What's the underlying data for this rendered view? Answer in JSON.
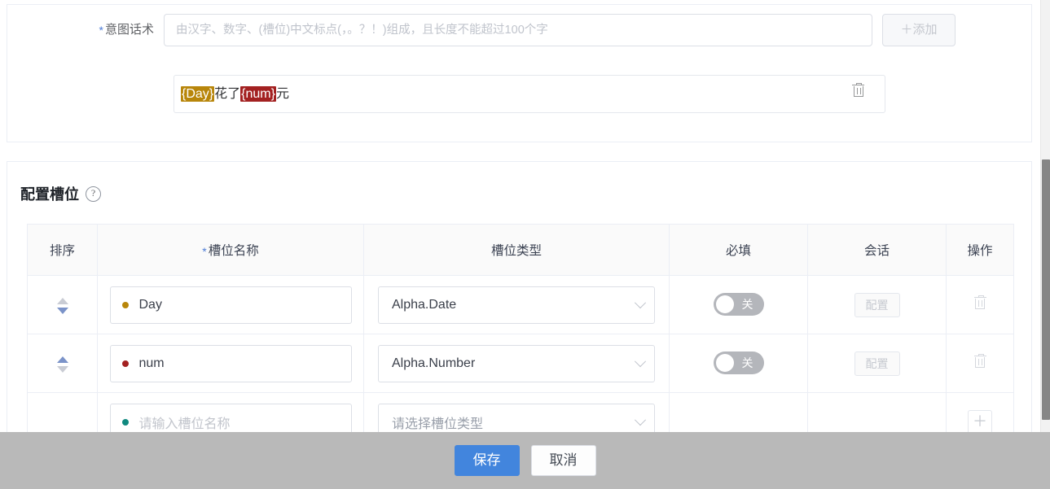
{
  "utterance_section": {
    "label": "意图话术",
    "required_mark": "*",
    "input_placeholder": "由汉字、数字、(槽位)中文标点(，。？！)组成，且长度不能超过100个字",
    "input_value": "",
    "add_button": "＋添加",
    "items": [
      {
        "parts": [
          {
            "text": "{Day}",
            "type": "slot",
            "color": "#b8860b"
          },
          {
            "text": "花了",
            "type": "plain",
            "color": ""
          },
          {
            "text": "{num}",
            "type": "slot",
            "color": "#a32121"
          },
          {
            "text": "元",
            "type": "plain",
            "color": ""
          }
        ],
        "delete_icon": "trash-icon"
      }
    ]
  },
  "slots_section": {
    "title": "配置槽位",
    "help_icon": "question-circle-icon",
    "help_glyph": "?",
    "table": {
      "columns": [
        {
          "key": "order",
          "label": "排序",
          "required": false
        },
        {
          "key": "name",
          "label": "槽位名称",
          "required": true
        },
        {
          "key": "type",
          "label": "槽位类型",
          "required": false
        },
        {
          "key": "required",
          "label": "必填",
          "required": false
        },
        {
          "key": "session",
          "label": "会话",
          "required": false
        },
        {
          "key": "action",
          "label": "操作",
          "required": false
        }
      ],
      "rows": [
        {
          "sort_up_active": false,
          "sort_down_active": true,
          "dot_color": "#b8860b",
          "name_value": "Day",
          "name_placeholder": "",
          "type_value": "Alpha.Date",
          "type_placeholder": "",
          "toggle_label": "关",
          "toggle_on": false,
          "session_button": "配置",
          "session_button_disabled": true,
          "action_icon": "trash-icon",
          "action_kind": "delete"
        },
        {
          "sort_up_active": true,
          "sort_down_active": false,
          "dot_color": "#a32121",
          "name_value": "num",
          "name_placeholder": "",
          "type_value": "Alpha.Number",
          "type_placeholder": "",
          "toggle_label": "关",
          "toggle_on": false,
          "session_button": "配置",
          "session_button_disabled": true,
          "action_icon": "trash-icon",
          "action_kind": "delete"
        },
        {
          "sort_up_active": false,
          "sort_down_active": false,
          "dot_color": "#10897f",
          "name_value": "",
          "name_placeholder": "请输入槽位名称",
          "type_value": "",
          "type_placeholder": "请选择槽位类型",
          "toggle_label": "",
          "toggle_on": false,
          "session_button": "",
          "session_button_disabled": true,
          "action_icon": "plus-icon",
          "action_kind": "add",
          "action_label": "＋"
        }
      ]
    }
  },
  "footer": {
    "save_label": "保存",
    "cancel_label": "取消",
    "primary_color": "#4285dd"
  },
  "scrollbar": {
    "orientation": "vertical",
    "visible": true
  }
}
